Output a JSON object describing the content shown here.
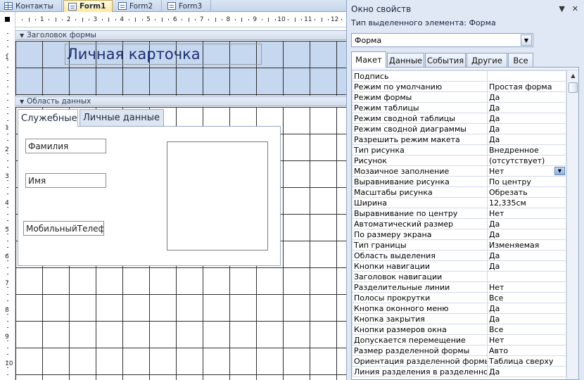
{
  "doc_tabs": [
    {
      "label": "Контакты",
      "icon": "table-icon"
    },
    {
      "label": "Form1",
      "icon": "form-icon",
      "active": true
    },
    {
      "label": "Form2",
      "icon": "form-icon"
    },
    {
      "label": "Form3",
      "icon": "form-icon"
    }
  ],
  "ruler": {
    "top_numbers": [
      "1",
      "2",
      "3",
      "4",
      "5",
      "6",
      "7",
      "8",
      "9",
      "10",
      "11",
      "12"
    ],
    "left_numbers": [
      "1",
      "1",
      "2",
      "3",
      "4",
      "5",
      "6",
      "7",
      "8",
      "9",
      "10"
    ]
  },
  "sections": {
    "header": "Заголовок формы",
    "detail": "Область данных"
  },
  "form": {
    "title": "Личная карточка",
    "tabs": [
      "Служебные",
      "Личные данные"
    ],
    "fields": {
      "surname": "Фамилия",
      "name": "Имя",
      "phone": "МобильныйТелеф"
    }
  },
  "property_sheet": {
    "title": "Окно свойств",
    "selection_label": "Тип выделенного элемента:  Форма",
    "selected_object": "Форма",
    "tabs": [
      "Макет",
      "Данные",
      "События",
      "Другие",
      "Все"
    ],
    "rows": [
      {
        "name": "Подпись",
        "value": ""
      },
      {
        "name": "Режим по умолчанию",
        "value": "Простая форма"
      },
      {
        "name": "Режим формы",
        "value": "Да"
      },
      {
        "name": "Режим таблицы",
        "value": "Да"
      },
      {
        "name": "Режим сводной таблицы",
        "value": "Да"
      },
      {
        "name": "Режим сводной диаграммы",
        "value": "Да"
      },
      {
        "name": "Разрешить режим макета",
        "value": "Да"
      },
      {
        "name": "Тип рисунка",
        "value": "Внедренное"
      },
      {
        "name": "Рисунок",
        "value": "(отсутствует)"
      },
      {
        "name": "Мозаичное заполнение",
        "value": "Нет"
      },
      {
        "name": "Выравнивание рисунка",
        "value": "По центру"
      },
      {
        "name": "Масштабы рисунка",
        "value": "Обрезать"
      },
      {
        "name": "Ширина",
        "value": "12,335см"
      },
      {
        "name": "Выравнивание по центру",
        "value": "Нет"
      },
      {
        "name": "Автоматический размер",
        "value": "Да"
      },
      {
        "name": "По размеру экрана",
        "value": "Да"
      },
      {
        "name": "Тип границы",
        "value": "Изменяемая"
      },
      {
        "name": "Область выделения",
        "value": "Да"
      },
      {
        "name": "Кнопки навигации",
        "value": "Да"
      },
      {
        "name": "Заголовок навигации",
        "value": ""
      },
      {
        "name": "Разделительные линии",
        "value": "Нет"
      },
      {
        "name": "Полосы прокрутки",
        "value": "Все"
      },
      {
        "name": "Кнопка оконного меню",
        "value": "Да"
      },
      {
        "name": "Кнопка закрытия",
        "value": "Да"
      },
      {
        "name": "Кнопки размеров окна",
        "value": "Все"
      },
      {
        "name": "Допускается перемещение",
        "value": "Нет"
      },
      {
        "name": "Размер разделенной формы",
        "value": "Авто"
      },
      {
        "name": "Ориентация разделенной формы",
        "value": "Таблица сверху"
      },
      {
        "name": "Линия разделения в разделенной форме",
        "value": "Да"
      }
    ]
  },
  "colors": {
    "header_fill": "#c6d8f0",
    "title_text": "#1d2e70",
    "panel_bg": "#dfe8f4"
  }
}
